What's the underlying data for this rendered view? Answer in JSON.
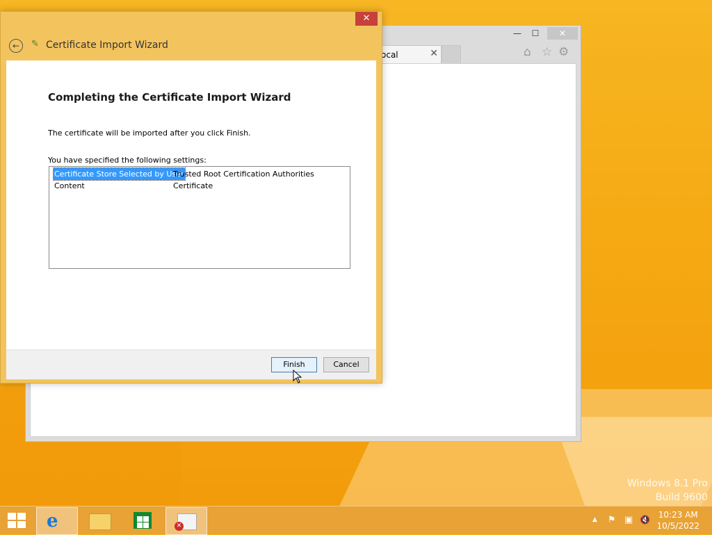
{
  "browser": {
    "tab_label": "ocal",
    "tab_close": "✕",
    "minimize": "—",
    "maximize": "☐",
    "close": "✕",
    "home_icon": "⌂",
    "favorites_icon": "☆",
    "settings_icon": "⚙"
  },
  "wizard": {
    "close": "✕",
    "back_icon": "←",
    "title": "Certificate Import Wizard",
    "heading": "Completing the Certificate Import Wizard",
    "info": "The certificate will be imported after you click Finish.",
    "settings_label": "You have specified the following settings:",
    "settings": [
      {
        "key": "Certificate Store Selected by User",
        "value": "Trusted Root Certification Authorities"
      },
      {
        "key": "Content",
        "value": "Certificate"
      }
    ],
    "finish_label": "Finish",
    "cancel_label": "Cancel"
  },
  "watermark": {
    "line1": "Windows 8.1 Pro",
    "line2": "Build 9600"
  },
  "taskbar": {
    "ie_glyph": "e",
    "tray_up": "▲",
    "tray_flag": "⚑",
    "tray_network": "▣",
    "tray_volume": "🔇",
    "time": "10:23 AM",
    "date": "10/5/2022"
  },
  "colors": {
    "accent": "#f5a912",
    "selection": "#3399ff",
    "close_red": "#c7403a"
  }
}
